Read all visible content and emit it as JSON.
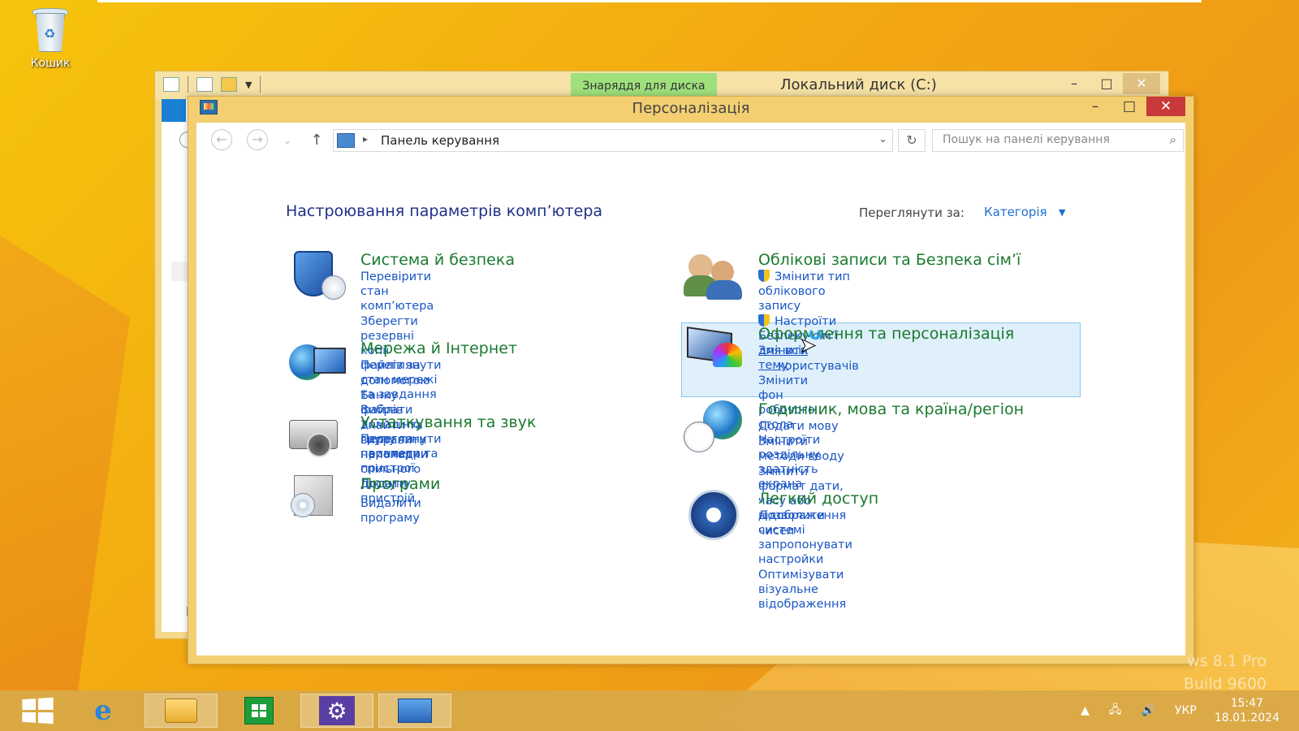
{
  "desktop": {
    "recycle_bin_label": "Кошик",
    "watermark_line1": "ws 8.1 Pro",
    "watermark_line2": "Build 9600"
  },
  "back_window": {
    "tools_tab": "Знаряддя для диска",
    "title": "Локальний диск (C:)",
    "side_letter": "E",
    "controls": {
      "minimize": "–",
      "maximize": "□",
      "close": "✕"
    }
  },
  "window": {
    "title": "Персоналізація",
    "controls": {
      "minimize": "–",
      "maximize": "□",
      "close": "✕"
    },
    "nav": {
      "back": "←",
      "forward": "→",
      "recent": "⌄",
      "up": "↑"
    },
    "address": {
      "separator": "▸",
      "path": "Панель керування",
      "dropdown": "⌄",
      "refresh": "↻"
    },
    "search": {
      "placeholder": "Пошук на панелі керування",
      "icon": "⌕"
    },
    "page_title": "Настроювання параметрів комп’ютера",
    "view_by": {
      "label": "Переглянути за:",
      "value": "Категорія",
      "caret": "▼"
    }
  },
  "categories_left": [
    {
      "title": "Система й безпека",
      "icon": "shield-icon",
      "links": [
        "Перевірити стан комп’ютера",
        "Зберегти резервні копії файлів за",
        "допомогою Банку файлів",
        "Знайти та виправити неполадки"
      ]
    },
    {
      "title": "Мережа й Інтернет",
      "icon": "network-icon",
      "links": [
        "Переглянути стан мережі та завдання",
        "Вибрати домашню групу та параметри",
        "спільного доступу"
      ]
    },
    {
      "title": "Устаткування та звук",
      "icon": "printer-icon",
      "links": [
        "Переглянути принтери та пристрої",
        "Додати пристрій"
      ]
    },
    {
      "title": "Програми",
      "icon": "programs-icon",
      "links": [
        "Видалити програму"
      ]
    }
  ],
  "categories_right": [
    {
      "title": "Облікові записи та Безпека сім’ї",
      "icon": "users-icon",
      "links": [
        "Змінити тип облікового запису",
        "Настроїти Безпеку сім’ї для всіх",
        "користувачів"
      ]
    },
    {
      "title": "Оформлення та персоналізація",
      "icon": "appearance-icon",
      "links": [
        "Змінити тему",
        "Змінити фон робочого стола",
        "Настроїти роздільну здатність екрана"
      ]
    },
    {
      "title": "Годинник, мова та країна/регіон",
      "icon": "clock-globe-icon",
      "links": [
        "Додати мову",
        "Змінити методи вводу",
        "Змінити формат дати, часу або відображення",
        "чисел"
      ]
    },
    {
      "title": "Легкий доступ",
      "icon": "accessibility-icon",
      "links": [
        "Дозволити системі запропонувати настройки",
        "Оптимізувати візуальне відображення"
      ]
    }
  ],
  "taskbar": {
    "tray_arrow": "▲",
    "language": "УКР",
    "time": "15:47",
    "date": "18.01.2024",
    "volume_icon": "🔊",
    "network_icon": "🖧"
  }
}
